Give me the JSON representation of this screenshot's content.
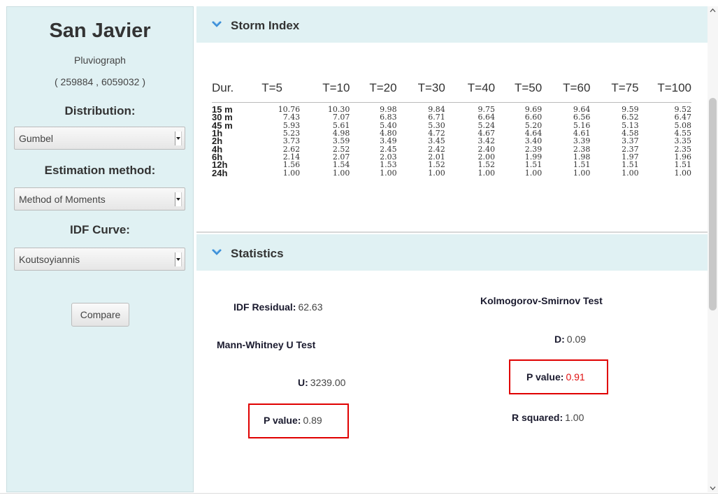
{
  "sidebar": {
    "title": "San Javier",
    "station_type": "Pluviograph",
    "coords": "( 259884 , 6059032 )",
    "distribution_label": "Distribution:",
    "distribution_value": "Gumbel",
    "estimation_label": "Estimation method:",
    "estimation_value": "Method of Moments",
    "idf_label": "IDF Curve:",
    "idf_value": "Koutsoyiannis",
    "compare_button": "Compare"
  },
  "storm_index": {
    "title": "Storm Index",
    "headers": [
      "Dur.",
      "T=5",
      "T=10",
      "T=20",
      "T=30",
      "T=40",
      "T=50",
      "T=60",
      "T=75",
      "T=100"
    ],
    "rows": [
      {
        "dur": "15 m",
        "values": [
          "10.76",
          "10.30",
          "9.98",
          "9.84",
          "9.75",
          "9.69",
          "9.64",
          "9.59",
          "9.52"
        ]
      },
      {
        "dur": "30 m",
        "values": [
          "7.43",
          "7.07",
          "6.83",
          "6.71",
          "6.64",
          "6.60",
          "6.56",
          "6.52",
          "6.47"
        ]
      },
      {
        "dur": "45 m",
        "values": [
          "5.93",
          "5.61",
          "5.40",
          "5.30",
          "5.24",
          "5.20",
          "5.16",
          "5.13",
          "5.08"
        ]
      },
      {
        "dur": "1h",
        "values": [
          "5.23",
          "4.98",
          "4.80",
          "4.72",
          "4.67",
          "4.64",
          "4.61",
          "4.58",
          "4.55"
        ]
      },
      {
        "dur": "2h",
        "values": [
          "3.73",
          "3.59",
          "3.49",
          "3.45",
          "3.42",
          "3.40",
          "3.39",
          "3.37",
          "3.35"
        ]
      },
      {
        "dur": "4h",
        "values": [
          "2.62",
          "2.52",
          "2.45",
          "2.42",
          "2.40",
          "2.39",
          "2.38",
          "2.37",
          "2.35"
        ]
      },
      {
        "dur": "6h",
        "values": [
          "2.14",
          "2.07",
          "2.03",
          "2.01",
          "2.00",
          "1.99",
          "1.98",
          "1.97",
          "1.96"
        ]
      },
      {
        "dur": "12h",
        "values": [
          "1.56",
          "1.54",
          "1.53",
          "1.52",
          "1.52",
          "1.51",
          "1.51",
          "1.51",
          "1.51"
        ]
      },
      {
        "dur": "24h",
        "values": [
          "1.00",
          "1.00",
          "1.00",
          "1.00",
          "1.00",
          "1.00",
          "1.00",
          "1.00",
          "1.00"
        ]
      }
    ]
  },
  "statistics": {
    "title": "Statistics",
    "idf_residual_label": "IDF Residual:",
    "idf_residual_value": "62.63",
    "mann_whitney_title": "Mann-Whitney U Test",
    "u_label": "U:",
    "u_value": "3239.00",
    "mw_p_label": "P value:",
    "mw_p_value": "0.89",
    "ks_title": "Kolmogorov-Smirnov Test",
    "d_label": "D:",
    "d_value": "0.09",
    "ks_p_label": "P value:",
    "ks_p_value": "0.91",
    "r2_label": "R squared:",
    "r2_value": "1.00"
  },
  "colors": {
    "panel_bg": "#e0f1f3",
    "chevron": "#3a8fd8",
    "highlight": "#e00000",
    "ks_p_value": "#e01010"
  },
  "icons": {
    "section_toggle": "chevron-down-icon",
    "select_arrow": "dropdown-arrow-icon"
  }
}
